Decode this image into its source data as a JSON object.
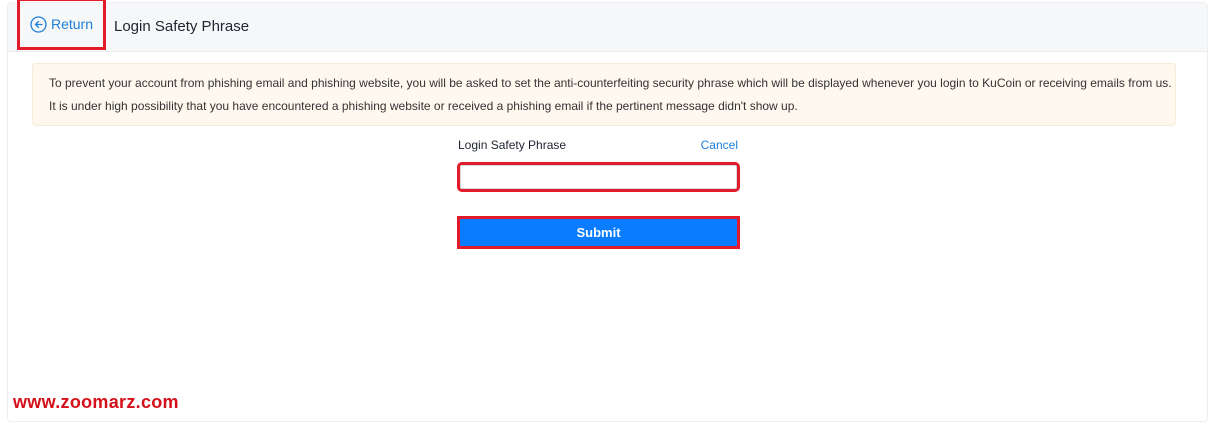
{
  "header": {
    "return_label": "Return",
    "title": "Login Safety Phrase",
    "return_icon": "arrow-left-circle-icon"
  },
  "notice": {
    "text": "To prevent your account from phishing email and phishing website, you will be asked to set the anti-counterfeiting security phrase which will be displayed whenever you login to KuCoin or receiving emails from us. It is under high possibility that you have encountered a phishing website or received a phishing email if the pertinent message didn't show up."
  },
  "form": {
    "label": "Login Safety Phrase",
    "cancel_label": "Cancel",
    "input_value": "",
    "submit_label": "Submit"
  },
  "watermark": {
    "text": "www.zoomarz.com"
  },
  "colors": {
    "accent": "#0a7cff",
    "link": "#1f7fd8",
    "highlight": "#e11b2a",
    "notice_bg": "#fff8ef",
    "watermark": "#d4101a"
  }
}
